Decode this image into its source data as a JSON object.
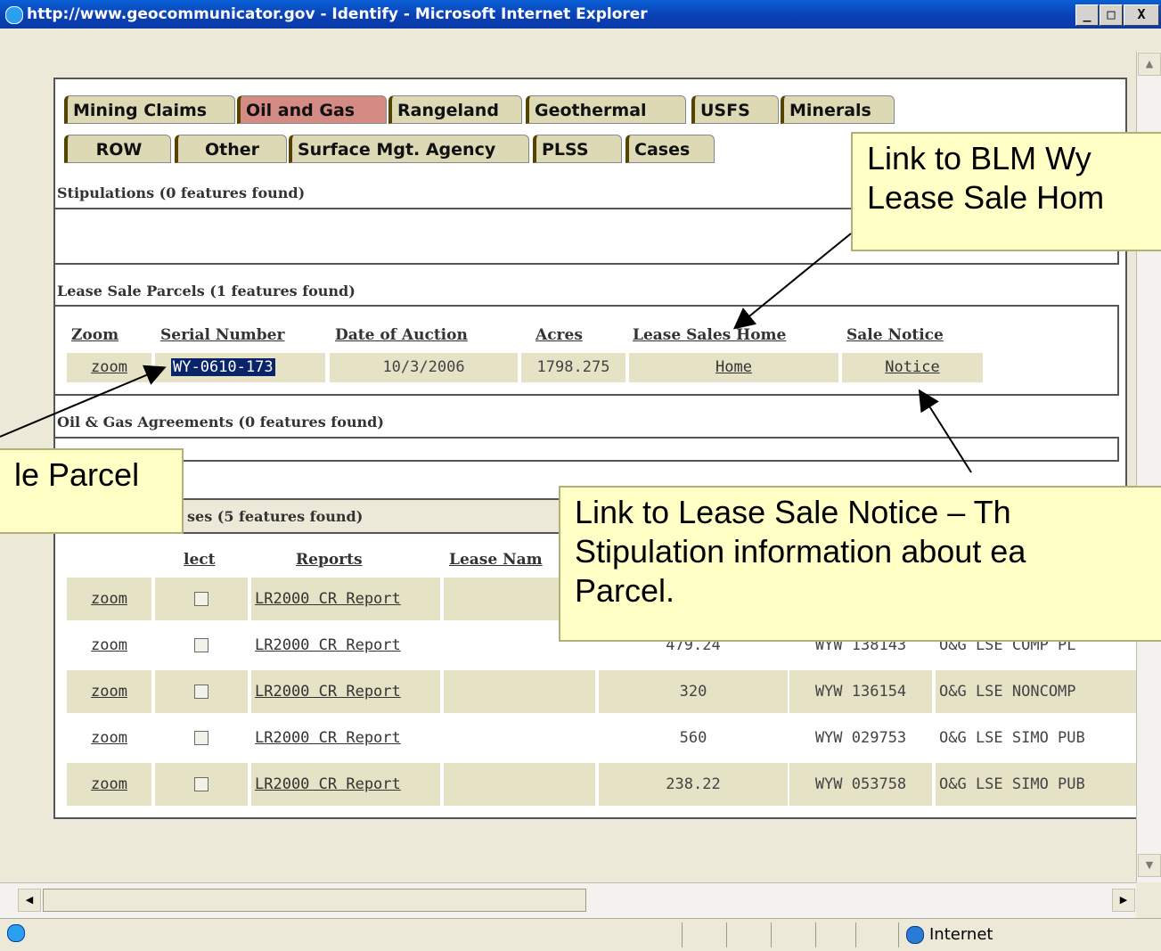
{
  "window": {
    "title": "http://www.geocommunicator.gov - Identify - Microsoft Internet Explorer",
    "controls": {
      "minimize": "_",
      "maximize": "□",
      "close": "X"
    }
  },
  "tabs": {
    "row1": [
      "Mining Claims",
      "Oil and Gas",
      "Rangeland",
      "Geothermal",
      "USFS",
      "Minerals"
    ],
    "row2": [
      "ROW",
      "Other",
      "Surface Mgt. Agency",
      "PLSS",
      "Cases"
    ],
    "active": "Oil and Gas"
  },
  "sections": {
    "stipulations": "Stipulations (0 features found)",
    "lease_sale_parcels": "Lease Sale Parcels (1 features found)",
    "agreements": "Oil & Gas Agreements (0 features found)",
    "leases": "ses (5 features found)"
  },
  "parcels": {
    "headers": [
      "Zoom",
      "Serial Number",
      "Date of Auction",
      "Acres",
      "Lease Sales Home",
      "Sale Notice"
    ],
    "row": {
      "zoom": "zoom",
      "serial": "WY-0610-173",
      "date": "10/3/2006",
      "acres": "1798.275",
      "home": "Home",
      "notice": "Notice"
    }
  },
  "leases": {
    "headers": [
      "lect",
      "Reports",
      "Lease Nam"
    ],
    "rows": [
      {
        "zoom": "zoom",
        "report": "LR2000 CR Report",
        "acres": "",
        "serial": "",
        "type": ""
      },
      {
        "zoom": "zoom",
        "report": "LR2000 CR Report",
        "acres": "479.24",
        "serial": "WYW 138143",
        "type": "O&G LSE COMP PL"
      },
      {
        "zoom": "zoom",
        "report": "LR2000 CR Report",
        "acres": "320",
        "serial": "WYW 136154",
        "type": "O&G LSE NONCOMP"
      },
      {
        "zoom": "zoom",
        "report": "LR2000 CR Report",
        "acres": "560",
        "serial": "WYW 029753",
        "type": "O&G LSE SIMO PUB"
      },
      {
        "zoom": "zoom",
        "report": "LR2000 CR Report",
        "acres": "238.22",
        "serial": "WYW 053758",
        "type": "O&G LSE SIMO PUB"
      }
    ]
  },
  "callouts": {
    "home": [
      "Link to BLM Wy",
      "Lease Sale Hom"
    ],
    "parcel": [
      "le Parcel"
    ],
    "notice": [
      "Link to Lease Sale Notice – Th",
      "Stipulation information about ea",
      "Parcel."
    ]
  },
  "status": {
    "zone": "Internet"
  }
}
